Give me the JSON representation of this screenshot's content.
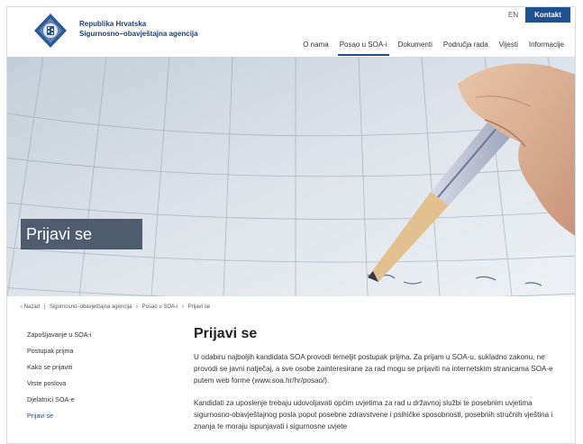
{
  "header": {
    "org_line1": "Republika Hrvatska",
    "org_line2": "Sigurnosno–obavještajna agencija",
    "lang": "EN",
    "contact": "Kontakt",
    "nav": [
      "O nama",
      "Posao u SOA-i",
      "Dokumenti",
      "Područja rada",
      "Vijesti",
      "Informacije"
    ],
    "nav_active_index": 1,
    "brand_color": "#1d4f91"
  },
  "hero": {
    "label": "Prijavi se"
  },
  "breadcrumb": {
    "back": "‹ Nazad",
    "sep": "|",
    "items": [
      "Sigurnosno–obavještajna agencija",
      "›",
      "Posao u SOA-i",
      "›",
      "Prijavi se"
    ]
  },
  "sidebar": {
    "items": [
      "Zapošljavanje u SOA-i",
      "Postupak prijma",
      "Kako se prijaviti",
      "Vrste poslova",
      "Djelatnici SOA-e",
      "Prijavi se"
    ],
    "active_index": 5
  },
  "main": {
    "title": "Prijavi se",
    "paragraphs": [
      "U odabiru najboljih kandidata SOA provodi temeljit postupak prijma. Za prijam u SOA-u, sukladno zakonu, ne provodi se javni natječaj, a sve osobe zainteresirane za rad mogu se prijaviti na internetskim stranicama SOA-e putem web forme (www.soa.hr/hr/posao/).",
      "Kandidati za uposlenje trebaju udovoljavati općim uvjetima za rad u državnoj službi te posebnim uvjetima sigurnosno-obavještajnog posla poput posebne zdravstvene i psihičke sposobnosti, posebnih stručnih vještina i znanja te moraju ispunjavati i sigurnosne uvjete"
    ]
  }
}
